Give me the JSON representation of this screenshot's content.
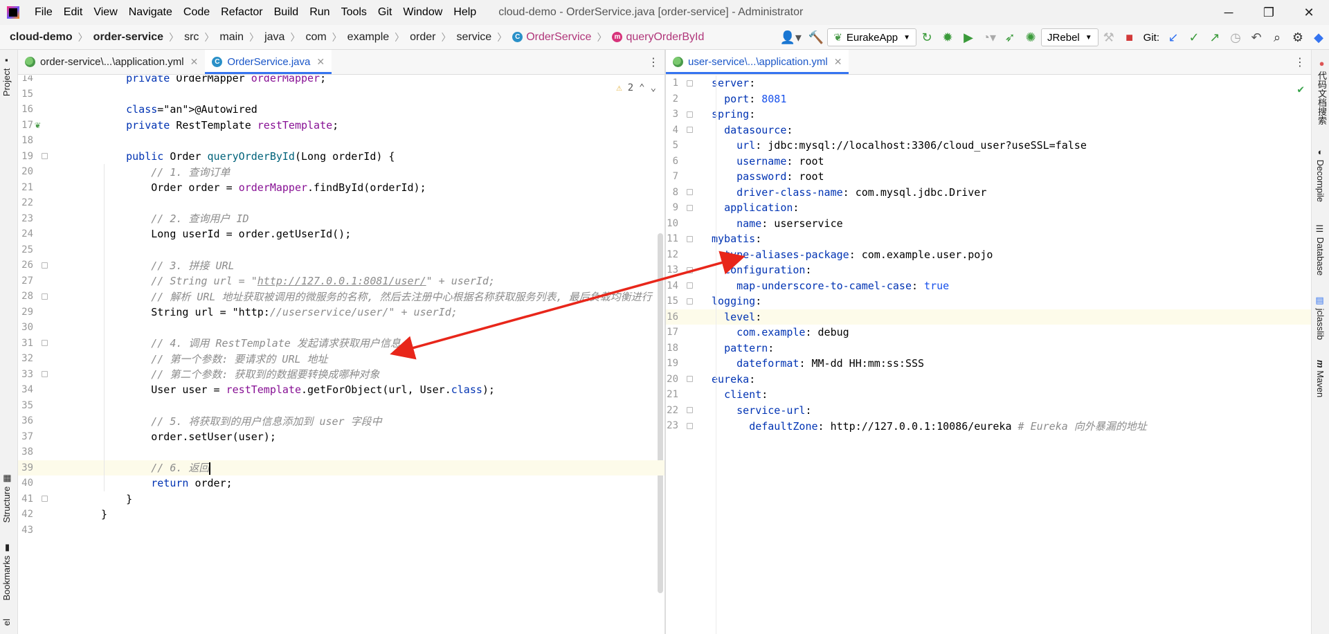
{
  "titlebar": {
    "menu": [
      "File",
      "Edit",
      "View",
      "Navigate",
      "Code",
      "Refactor",
      "Build",
      "Run",
      "Tools",
      "Git",
      "Window",
      "Help"
    ],
    "window_title": "cloud-demo - OrderService.java [order-service] - Administrator",
    "controls": {
      "minimize": "─",
      "restore": "❐",
      "close": "✕"
    }
  },
  "breadcrumbs": [
    "cloud-demo",
    "order-service",
    "src",
    "main",
    "java",
    "com",
    "example",
    "order",
    "service",
    "OrderService",
    "queryOrderById"
  ],
  "breadcrumb_icons": {
    "class_icon": "C",
    "method_icon": "m"
  },
  "toolbar": {
    "run_config": "EurakeApp",
    "jrebel": "JRebel",
    "git_label": "Git:"
  },
  "left_tool_windows": [
    "Project",
    "Structure",
    "Bookmarks",
    "el"
  ],
  "right_tool_windows": [
    "代码文档搜索",
    "Decompile",
    "Database",
    "jclasslib",
    "Maven"
  ],
  "left_editor": {
    "tabs": [
      {
        "label": "order-service\\...\\application.yml",
        "icon": "yml-icon",
        "active": false
      },
      {
        "label": "OrderService.java",
        "icon": "class-icon",
        "active": true
      }
    ],
    "inspection": {
      "warning_count": "2",
      "up": "⌃",
      "down": "⌄"
    },
    "first_line": 14,
    "lines": [
      {
        "n": "14",
        "code": "    private OrderMapper orderMapper;"
      },
      {
        "n": "15",
        "code": ""
      },
      {
        "n": "16",
        "code": "    @Autowired"
      },
      {
        "n": "17",
        "code": "    private RestTemplate restTemplate;"
      },
      {
        "n": "18",
        "code": ""
      },
      {
        "n": "19",
        "code": "    public Order queryOrderById(Long orderId) {"
      },
      {
        "n": "20",
        "code": "        // 1. 查询订单"
      },
      {
        "n": "21",
        "code": "        Order order = orderMapper.findById(orderId);"
      },
      {
        "n": "22",
        "code": ""
      },
      {
        "n": "23",
        "code": "        // 2. 查询用户 ID"
      },
      {
        "n": "24",
        "code": "        Long userId = order.getUserId();"
      },
      {
        "n": "25",
        "code": ""
      },
      {
        "n": "26",
        "code": "        // 3. 拼接 URL"
      },
      {
        "n": "27",
        "code": "        // String url = \"http://127.0.0.1:8081/user/\" + userId;"
      },
      {
        "n": "28",
        "code": "        // 解析 URL 地址获取被调用的微服务的名称, 然后去注册中心根据名称获取服务列表, 最后负载均衡进行"
      },
      {
        "n": "29",
        "code": "        String url = \"http://userservice/user/\" + userId;"
      },
      {
        "n": "30",
        "code": ""
      },
      {
        "n": "31",
        "code": "        // 4. 调用 RestTemplate 发起请求获取用户信息"
      },
      {
        "n": "32",
        "code": "        // 第一个参数: 要请求的 URL 地址"
      },
      {
        "n": "33",
        "code": "        // 第二个参数: 获取到的数据要转换成哪种对象"
      },
      {
        "n": "34",
        "code": "        User user = restTemplate.getForObject(url, User.class);"
      },
      {
        "n": "35",
        "code": ""
      },
      {
        "n": "36",
        "code": "        // 5. 将获取到的用户信息添加到 user 字段中"
      },
      {
        "n": "37",
        "code": "        order.setUser(user);"
      },
      {
        "n": "38",
        "code": ""
      },
      {
        "n": "39",
        "code": "        // 6. 返回"
      },
      {
        "n": "40",
        "code": "        return order;"
      },
      {
        "n": "41",
        "code": "    }"
      },
      {
        "n": "42",
        "code": "}"
      },
      {
        "n": "43",
        "code": ""
      }
    ]
  },
  "right_editor": {
    "tabs": [
      {
        "label": "user-service\\...\\application.yml",
        "icon": "yml-icon",
        "active": true
      }
    ],
    "status_icon": "check-icon",
    "lines": [
      {
        "n": "1",
        "code": "server:"
      },
      {
        "n": "2",
        "code": "  port: 8081"
      },
      {
        "n": "3",
        "code": "spring:"
      },
      {
        "n": "4",
        "code": "  datasource:"
      },
      {
        "n": "5",
        "code": "    url: jdbc:mysql://localhost:3306/cloud_user?useSSL=false"
      },
      {
        "n": "6",
        "code": "    username: root"
      },
      {
        "n": "7",
        "code": "    password: root"
      },
      {
        "n": "8",
        "code": "    driver-class-name: com.mysql.jdbc.Driver"
      },
      {
        "n": "9",
        "code": "  application:"
      },
      {
        "n": "10",
        "code": "    name: userservice"
      },
      {
        "n": "11",
        "code": "mybatis:"
      },
      {
        "n": "12",
        "code": "  type-aliases-package: com.example.user.pojo"
      },
      {
        "n": "13",
        "code": "  configuration:"
      },
      {
        "n": "14",
        "code": "    map-underscore-to-camel-case: true"
      },
      {
        "n": "15",
        "code": "logging:"
      },
      {
        "n": "16",
        "code": "  level:"
      },
      {
        "n": "17",
        "code": "    com.example: debug"
      },
      {
        "n": "18",
        "code": "  pattern:"
      },
      {
        "n": "19",
        "code": "    dateformat: MM-dd HH:mm:ss:SSS"
      },
      {
        "n": "20",
        "code": "eureka:"
      },
      {
        "n": "21",
        "code": "  client:"
      },
      {
        "n": "22",
        "code": "    service-url:"
      },
      {
        "n": "23",
        "code": "      defaultZone: http://127.0.0.1:10086/eureka # Eureka 向外暴漏的地址"
      }
    ]
  },
  "annotation": {
    "color": "#e8261a"
  }
}
